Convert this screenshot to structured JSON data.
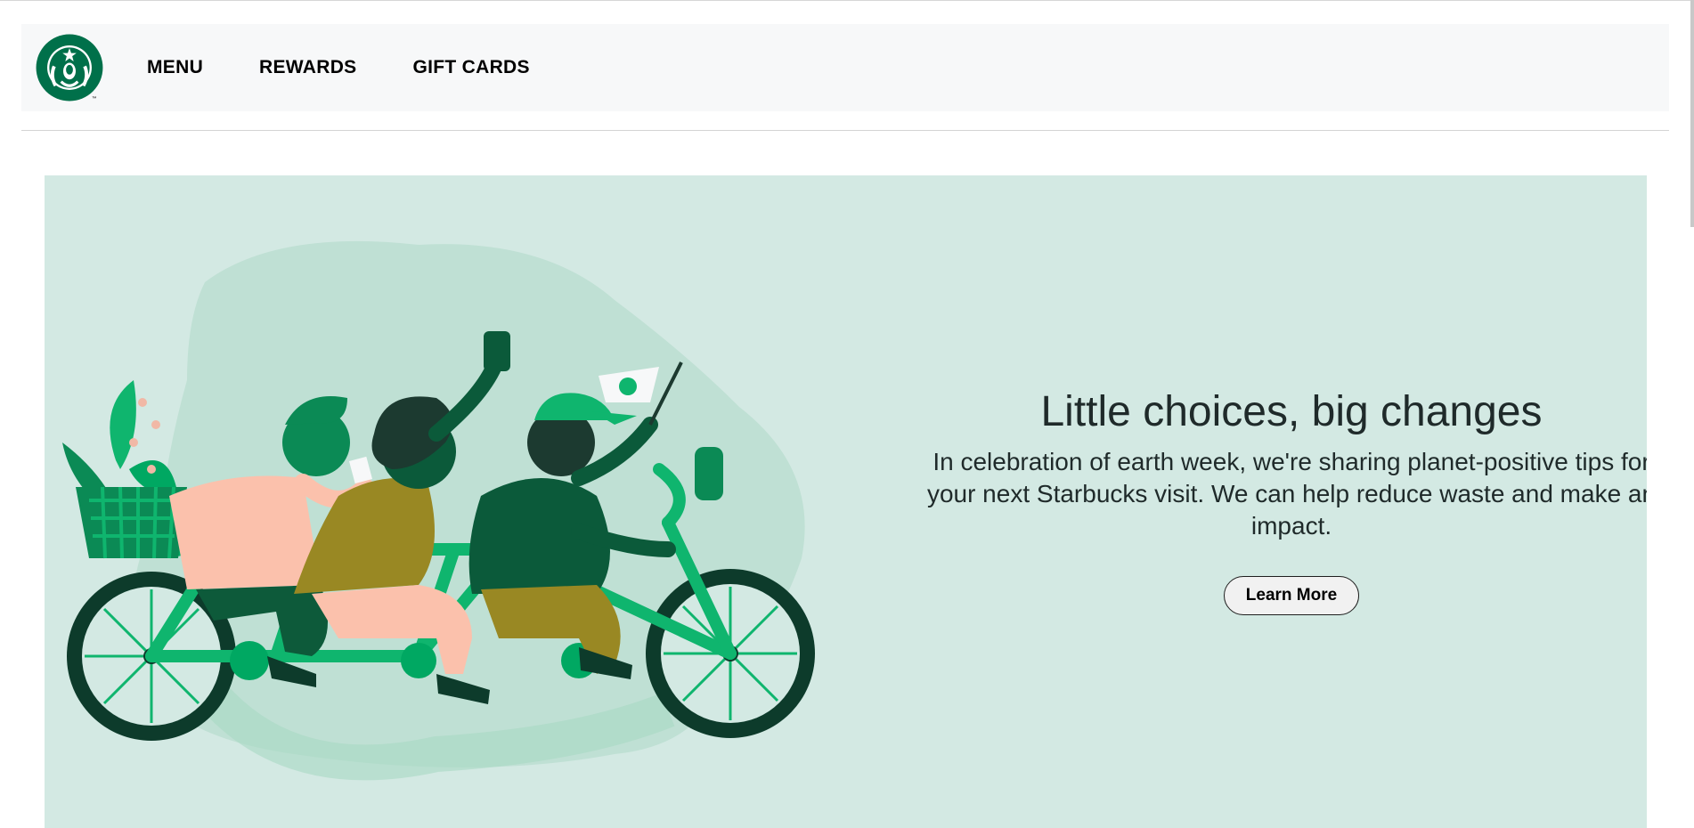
{
  "nav": {
    "logo_alt": "Starbucks logo",
    "items": [
      {
        "label": "MENU"
      },
      {
        "label": "REWARDS"
      },
      {
        "label": "GIFT CARDS"
      }
    ]
  },
  "hero": {
    "title": "Little choices, big changes",
    "body": "In celebration of earth week, we're sharing planet-positive tips for your next Starbucks visit. We can help reduce waste and make an impact.",
    "cta_label": "Learn More",
    "background_color": "#d3e9e3",
    "illustration": "three-people-riding-tandem-bicycle-illustration"
  },
  "colors": {
    "brand_green": "#00704a",
    "header_bg": "#f7f8f9"
  }
}
